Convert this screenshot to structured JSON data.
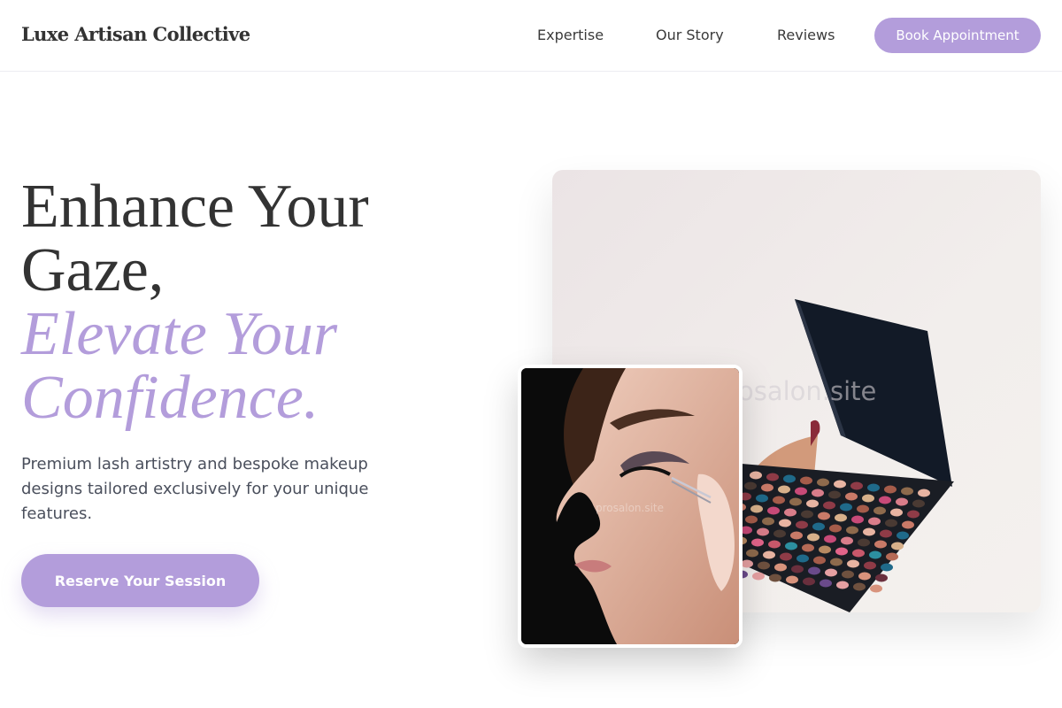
{
  "brand": {
    "name": "Luxe Artisan Collective"
  },
  "nav": {
    "links": [
      "Expertise",
      "Our Story",
      "Reviews"
    ],
    "cta_label": "Book Appointment"
  },
  "hero": {
    "title_lines": [
      "Enhance Your",
      "Gaze,"
    ],
    "accent_lines": [
      "Elevate Your",
      "Confidence."
    ],
    "subtitle": "Premium lash artistry and bespoke makeup designs tailored exclusively for your unique features.",
    "cta_label": "Reserve Your Session"
  },
  "images": {
    "main": {
      "subject": "open eyeshadow palette held in hand",
      "watermark": "osalon.site"
    },
    "inset": {
      "subject": "close-up profile of lash application with tweezers",
      "watermark": "prosalon.site"
    }
  },
  "colors": {
    "accent": "#b39ddb",
    "text": "#333333",
    "subtext": "#4a4f5c",
    "background": "#ffffff"
  }
}
